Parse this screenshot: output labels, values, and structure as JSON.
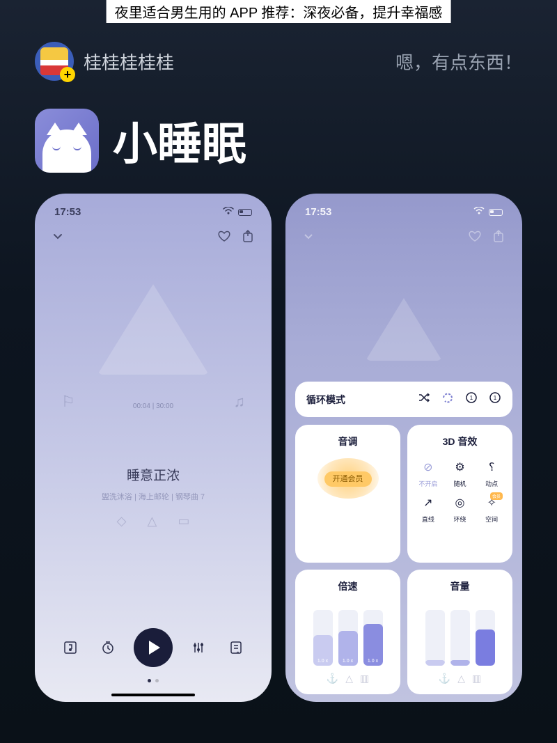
{
  "banner": "夜里适合男生用的 APP 推荐：深夜必备，提升幸福感",
  "author": {
    "name": "桂桂桂桂桂"
  },
  "tagline": "嗯，有点东西！",
  "app": {
    "name": "小睡眠"
  },
  "phone_left": {
    "time": "17:53",
    "playback": "00:04 | 30:00",
    "song_title": "睡意正浓",
    "song_sub": "盥洗沐浴 | 海上邮轮 | 钢琴曲 7"
  },
  "phone_right": {
    "time": "17:53",
    "loop": {
      "title": "循环模式"
    },
    "tone": {
      "title": "音调",
      "vip": "开通会员"
    },
    "fx3d": {
      "title": "3D 音效",
      "items": [
        "不开启",
        "随机",
        "动点",
        "直线",
        "环绕",
        "空间"
      ]
    },
    "speed": {
      "title": "倍速",
      "bars": [
        {
          "label": "1.0 x",
          "pct": 55,
          "color": "#c9cbf0"
        },
        {
          "label": "1.0 x",
          "pct": 62,
          "color": "#b0b3ea"
        },
        {
          "label": "1.0 x",
          "pct": 75,
          "color": "#8a8de0"
        }
      ]
    },
    "volume": {
      "title": "音量",
      "bars": [
        {
          "pct": 10,
          "color": "#c9cbf0"
        },
        {
          "pct": 10,
          "color": "#b0b3ea"
        },
        {
          "pct": 65,
          "color": "#7a7de0"
        }
      ]
    }
  }
}
